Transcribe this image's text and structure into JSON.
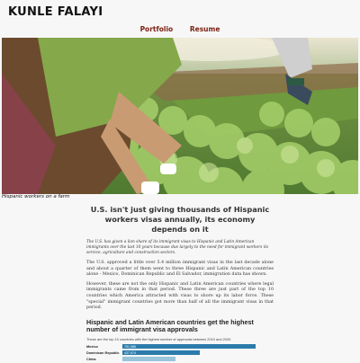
{
  "site": {
    "title": "KUNLE FALAYI"
  },
  "nav": {
    "items": [
      "Portfolio",
      "Resume"
    ]
  },
  "hero": {
    "caption": "Hispanic workers on a farm"
  },
  "article": {
    "headline": "U.S. isn't just giving thousands of Hispanic workers visas annually, its economy depends on it",
    "lede": "The U.S. has given a lion share of its immigrant visas to Hispanic and Latin American immigrants over the last 10 years because due largely to the need for immigrant workers its service, agriculture and construction sectors.",
    "paragraphs": [
      "The U.S. approved a little over 5.4 million immigrant visas in the last decade alone and about a quarter of them went to three Hispanic and Latin American countries alone - Mexico, Dominican Republic and El Salvador, immigration data has shown.",
      "However, these are not the only Hispanic and Latin American countries where legal immigrants came from in that period. These three are just part of the top 10 countries which America attracted with visas to shore up its labor force. These \"special\" immigrant countries got more than half of all the immigrant visas in that period."
    ]
  },
  "chart_data": {
    "type": "bar",
    "title": "Hispanic and Latin American countries get the highest number of immigrant visa approvals",
    "subtitle": "These are the top 10 countries with the highest number of approvals between 2010 and 2020.",
    "categories": [
      "Mexico",
      "Dominican Republic",
      "China"
    ],
    "values": [
      751986,
      437974,
      301000
    ],
    "value_labels": [
      "751,986",
      "437,974",
      ""
    ],
    "max": 852000,
    "colors": {
      "bar": "#2b7bab",
      "bar_light": "#9bc4dd"
    }
  },
  "colors": {
    "nav_link": "#7a1f10",
    "background": "#f7f7f7"
  }
}
